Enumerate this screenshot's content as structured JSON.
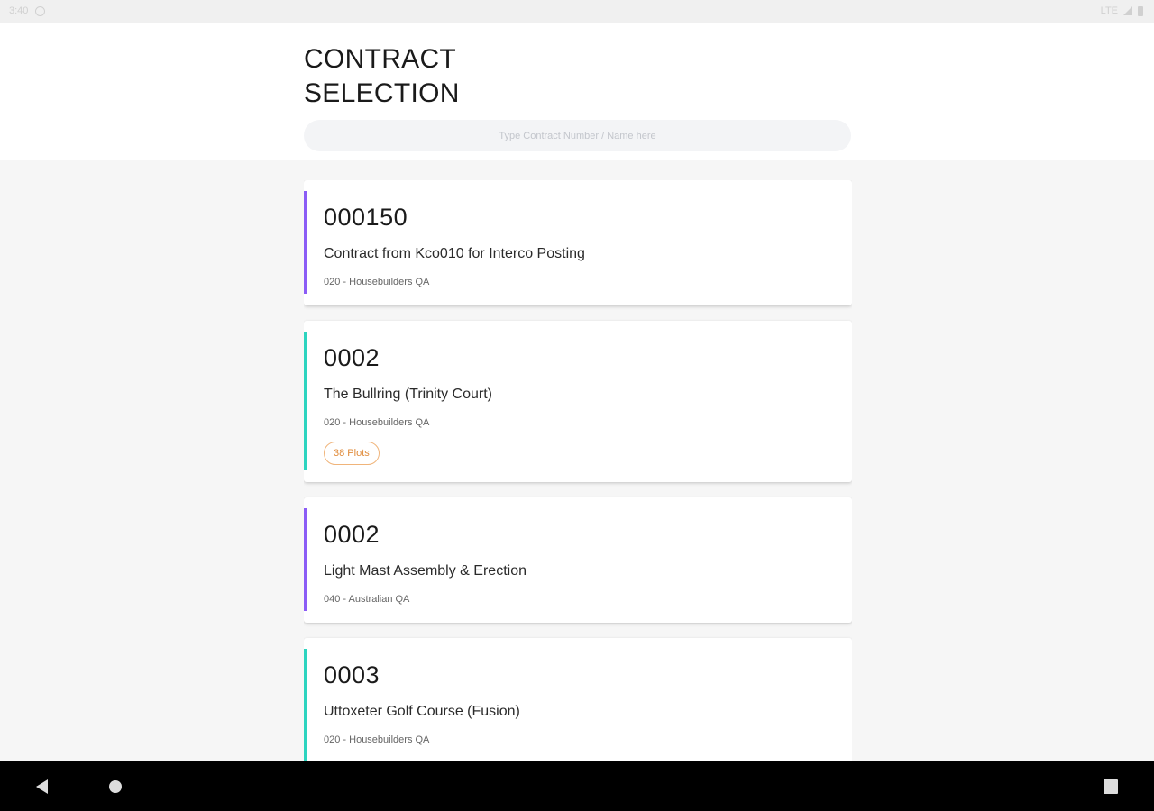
{
  "status_bar": {
    "time": "3:40",
    "icons": [
      "notification-icon",
      "wifi-icon",
      "signal-icon",
      "battery-icon"
    ],
    "network": "LTE"
  },
  "header": {
    "title": "CONTRACT\nSELECTION",
    "search": {
      "placeholder": "Type Contract Number / Name here",
      "value": ""
    }
  },
  "colors": {
    "purple_accent": "#8b5cf6",
    "teal_accent": "#2dd4bf",
    "badge_orange": "#e08b3a"
  },
  "contracts": [
    {
      "number": "000150",
      "name": "Contract from Kco010 for Interco Posting",
      "company": "020 - Housebuilders QA",
      "accent": "purple",
      "plots": ""
    },
    {
      "number": "0002",
      "name": "The Bullring (Trinity Court)",
      "company": "020 - Housebuilders QA",
      "accent": "teal",
      "plots": "38 Plots"
    },
    {
      "number": "0002",
      "name": "Light Mast Assembly & Erection",
      "company": "040 - Australian QA",
      "accent": "purple",
      "plots": ""
    },
    {
      "number": "0003",
      "name": "Uttoxeter Golf Course (Fusion)",
      "company": "020 - Housebuilders QA",
      "accent": "teal",
      "plots": ""
    }
  ],
  "nav_bar": {
    "buttons": [
      "back-icon",
      "home-icon",
      "recents-icon"
    ]
  }
}
